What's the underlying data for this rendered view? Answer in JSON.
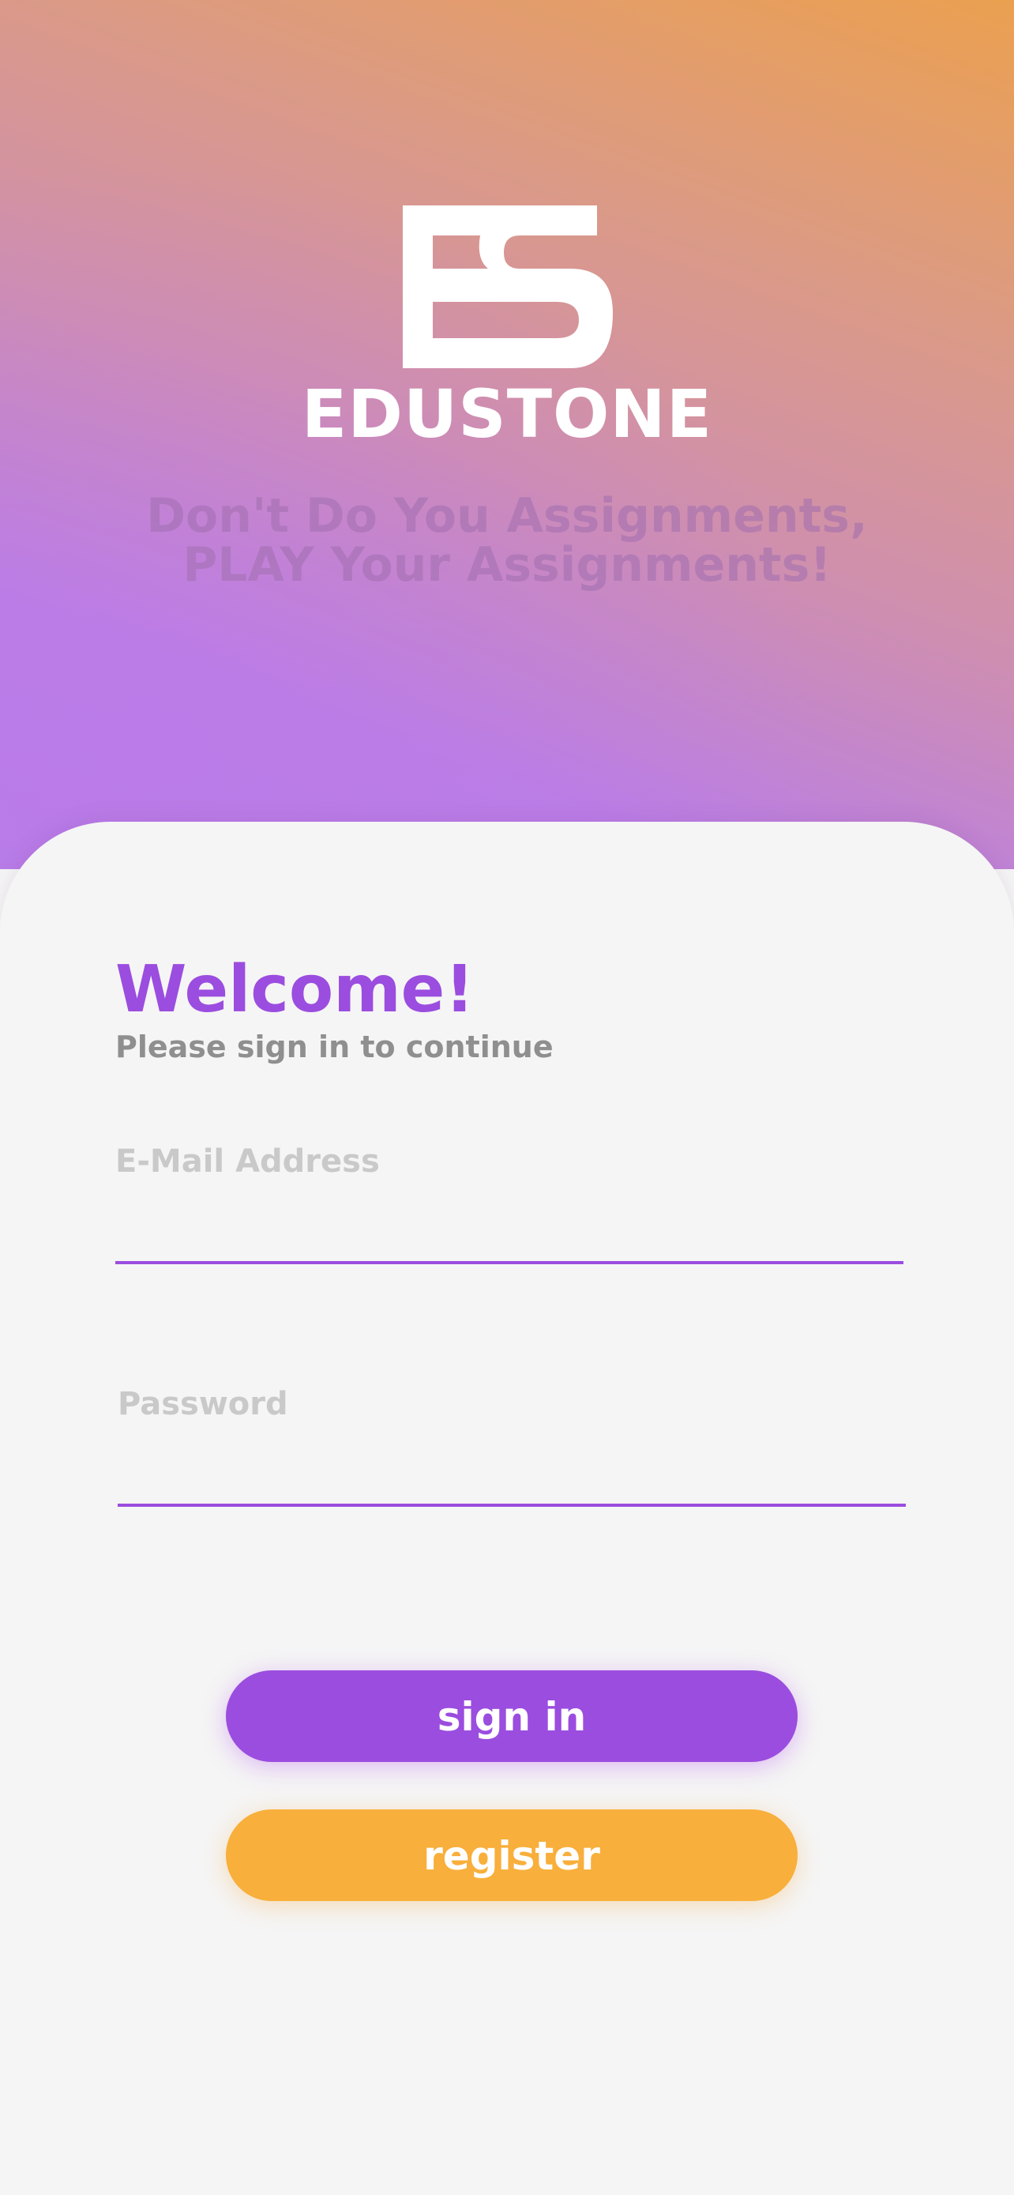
{
  "brand": {
    "name": "EDUSTONE",
    "tagline_line1": "Don't Do You Assignments,",
    "tagline_line2": "PLAY Your Assignments!"
  },
  "login": {
    "heading": "Welcome!",
    "subheading": "Please sign in to continue",
    "email_label": "E-Mail Address",
    "email_value": "",
    "password_label": "Password",
    "password_value": "",
    "signin_label": "sign in",
    "register_label": "register"
  },
  "icons": {
    "logo": "edustone-logo-icon"
  },
  "colors": {
    "accent_purple": "#9b4ddf",
    "accent_orange": "#f8af3b",
    "gradient_top": "#eba050",
    "gradient_bottom": "#b57de6",
    "card_background": "#f5f5f5"
  }
}
